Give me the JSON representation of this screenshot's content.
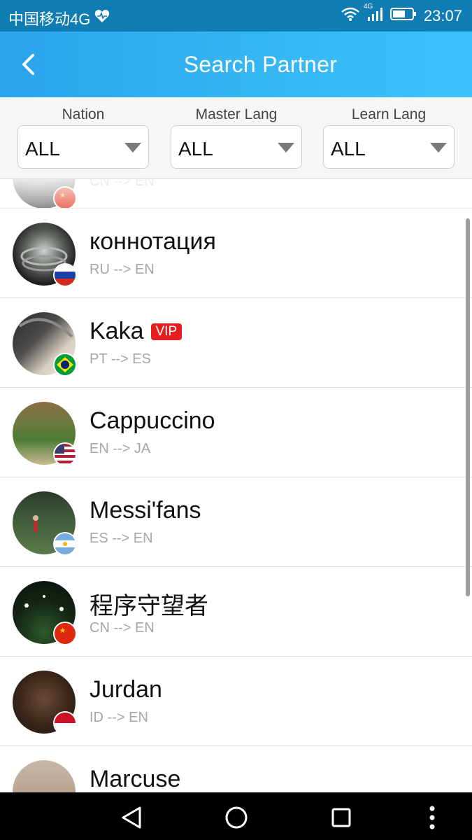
{
  "status_bar": {
    "carrier": "中国移动4G",
    "network": "4G",
    "time": "23:07"
  },
  "header": {
    "title": "Search Partner",
    "back_icon": "chevron-left-icon"
  },
  "filters": [
    {
      "label": "Nation",
      "value": "ALL"
    },
    {
      "label": "Master Lang",
      "value": "ALL"
    },
    {
      "label": "Learn Lang",
      "value": "ALL"
    }
  ],
  "partners": [
    {
      "name": "",
      "lang": "CN --> EN",
      "flag": "cn",
      "vip": ""
    },
    {
      "name": "коннотация",
      "lang": "RU --> EN",
      "flag": "ru",
      "vip": ""
    },
    {
      "name": "Kaka",
      "lang": "PT --> ES",
      "flag": "br",
      "vip": "VIP"
    },
    {
      "name": "Cappuccino",
      "lang": "EN --> JA",
      "flag": "us",
      "vip": ""
    },
    {
      "name": "Messi'fans",
      "lang": "ES --> EN",
      "flag": "ar",
      "vip": ""
    },
    {
      "name": "程序守望者",
      "lang": "CN --> EN",
      "flag": "cn",
      "vip": ""
    },
    {
      "name": "Jurdan",
      "lang": "ID --> EN",
      "flag": "id",
      "vip": ""
    },
    {
      "name": "Marcuse",
      "lang": "",
      "flag": "",
      "vip": ""
    }
  ],
  "nav": {
    "back_icon": "triangle-back-icon",
    "home_icon": "circle-home-icon",
    "recents_icon": "square-recents-icon",
    "menu_icon": "dots-menu-icon"
  }
}
